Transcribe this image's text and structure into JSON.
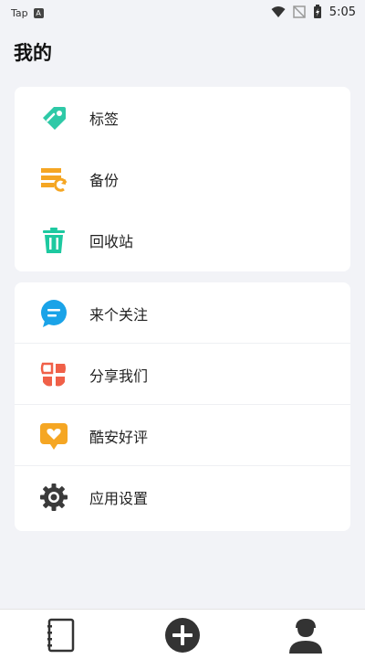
{
  "status_bar": {
    "left_text": "Tap",
    "left_badge": "A",
    "time": "5:05",
    "icons": [
      "wifi-icon",
      "no-signal-icon",
      "battery-charging-icon"
    ]
  },
  "page": {
    "title": "我的"
  },
  "groups": [
    {
      "items": [
        {
          "label": "标签",
          "icon": "tag-icon",
          "color": "#2ec9a7"
        },
        {
          "label": "备份",
          "icon": "backup-icon",
          "color": "#f5a623"
        },
        {
          "label": "回收站",
          "icon": "trash-icon",
          "color": "#1dc9a0"
        }
      ]
    },
    {
      "items": [
        {
          "label": "来个关注",
          "icon": "chat-bubble-icon",
          "color": "#1aa3e8"
        },
        {
          "label": "分享我们",
          "icon": "share-icon",
          "color": "#f06048"
        },
        {
          "label": "酷安好评",
          "icon": "heart-message-icon",
          "color": "#f5a623"
        },
        {
          "label": "应用设置",
          "icon": "gear-icon",
          "color": "#3a3a3a"
        }
      ]
    }
  ],
  "bottom_nav": [
    {
      "icon": "notebook-icon"
    },
    {
      "icon": "add-circle-icon"
    },
    {
      "icon": "profile-icon"
    }
  ]
}
